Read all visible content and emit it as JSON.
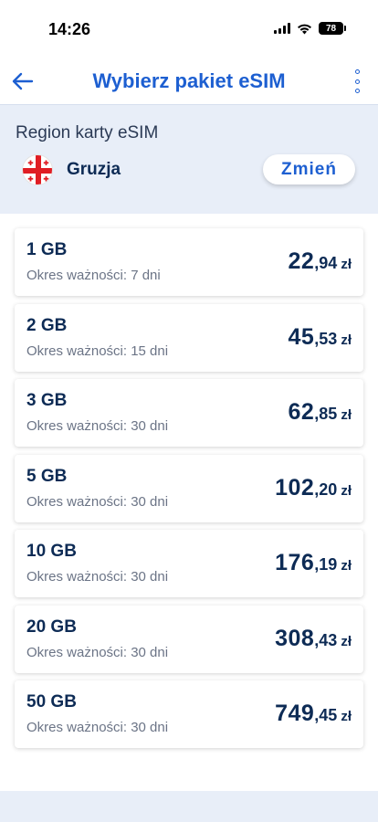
{
  "status_bar": {
    "time": "14:26",
    "battery": "78"
  },
  "header": {
    "title": "Wybierz pakiet eSIM",
    "back_icon": "arrow-left-icon",
    "more_icon": "vertical-dots-icon"
  },
  "region": {
    "label": "Region karty eSIM",
    "country": "Gruzja",
    "flag_icon": "georgia-flag-icon",
    "change_label": "Zmień"
  },
  "colors": {
    "accent": "#1d5fd1",
    "text_dark": "#0d2b55",
    "region_bg": "#e8eef8"
  },
  "packages": [
    {
      "size": "1 GB",
      "validity": "Okres ważności: 7 dni",
      "price_int": "22",
      "price_dec": ",94",
      "currency": "zł"
    },
    {
      "size": "2 GB",
      "validity": "Okres ważności: 15 dni",
      "price_int": "45",
      "price_dec": ",53",
      "currency": "zł"
    },
    {
      "size": "3 GB",
      "validity": "Okres ważności: 30 dni",
      "price_int": "62",
      "price_dec": ",85",
      "currency": "zł"
    },
    {
      "size": "5 GB",
      "validity": "Okres ważności: 30 dni",
      "price_int": "102",
      "price_dec": ",20",
      "currency": "zł"
    },
    {
      "size": "10 GB",
      "validity": "Okres ważności: 30 dni",
      "price_int": "176",
      "price_dec": ",19",
      "currency": "zł"
    },
    {
      "size": "20 GB",
      "validity": "Okres ważności: 30 dni",
      "price_int": "308",
      "price_dec": ",43",
      "currency": "zł"
    },
    {
      "size": "50 GB",
      "validity": "Okres ważności: 30 dni",
      "price_int": "749",
      "price_dec": ",45",
      "currency": "zł"
    }
  ]
}
